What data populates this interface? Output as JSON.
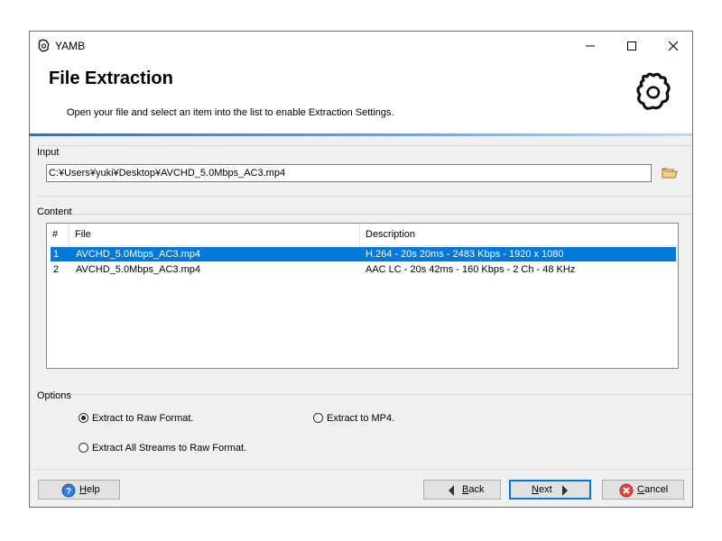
{
  "window": {
    "title": "YAMB",
    "minimize": "—",
    "maximize": "☐",
    "close": "✕"
  },
  "header": {
    "title": "File Extraction",
    "subtitle": "Open your file and select an item into the list to enable Extraction Settings."
  },
  "input": {
    "group_label": "Input",
    "path": "C:¥Users¥yuki¥Desktop¥AVCHD_5.0Mbps_AC3.mp4",
    "folder_icon": "folder-open-icon"
  },
  "content": {
    "group_label": "Content",
    "columns": [
      "#",
      "File",
      "Description"
    ],
    "rows": [
      {
        "num": "1",
        "file": "AVCHD_5.0Mbps_AC3.mp4",
        "description": "H.264 - 20s 20ms - 2483 Kbps - 1920 x 1080",
        "selected": true
      },
      {
        "num": "2",
        "file": "AVCHD_5.0Mbps_AC3.mp4",
        "description": "AAC LC - 20s 42ms - 160 Kbps - 2 Ch - 48 KHz",
        "selected": false
      }
    ]
  },
  "options": {
    "group_label": "Options",
    "raw": "Extract to Raw Format.",
    "mp4": "Extract to MP4.",
    "all_raw": "Extract All Streams to Raw Format.",
    "selected": "raw"
  },
  "buttons": {
    "help": {
      "hotkey": "H",
      "rest": "elp"
    },
    "back": {
      "hotkey": "B",
      "rest": "ack"
    },
    "next": {
      "hotkey": "N",
      "rest": "ext"
    },
    "cancel": {
      "hotkey": "C",
      "rest": "ancel"
    }
  },
  "colors": {
    "selection": "#0078d7",
    "accent_line": "#3a6ea8",
    "window_bg": "#f0f0f0"
  }
}
